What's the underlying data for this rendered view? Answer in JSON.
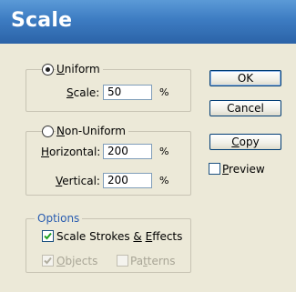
{
  "window": {
    "title": "Scale"
  },
  "uniform": {
    "label_parts": [
      "",
      "U",
      "niform"
    ],
    "scale_label_parts": [
      "",
      "S",
      "cale:"
    ],
    "scale_value": "50",
    "unit": "%"
  },
  "non_uniform": {
    "label_parts": [
      "",
      "N",
      "on-Uniform"
    ],
    "horizontal_label_parts": [
      "",
      "H",
      "orizontal:"
    ],
    "horizontal_value": "200",
    "vertical_label_parts": [
      "",
      "V",
      "ertical:"
    ],
    "vertical_value": "200",
    "unit": "%"
  },
  "options": {
    "title": "Options",
    "scale_strokes_parts": [
      "Scale Strokes ",
      "&",
      " ",
      "E",
      "ffects"
    ],
    "objects_parts": [
      "",
      "O",
      "bjects"
    ],
    "patterns_parts": [
      "Pa",
      "t",
      "terns"
    ]
  },
  "buttons": {
    "ok": "OK",
    "cancel": "Cancel",
    "copy_parts": [
      "",
      "C",
      "opy"
    ],
    "preview_parts": [
      "",
      "P",
      "review"
    ]
  }
}
